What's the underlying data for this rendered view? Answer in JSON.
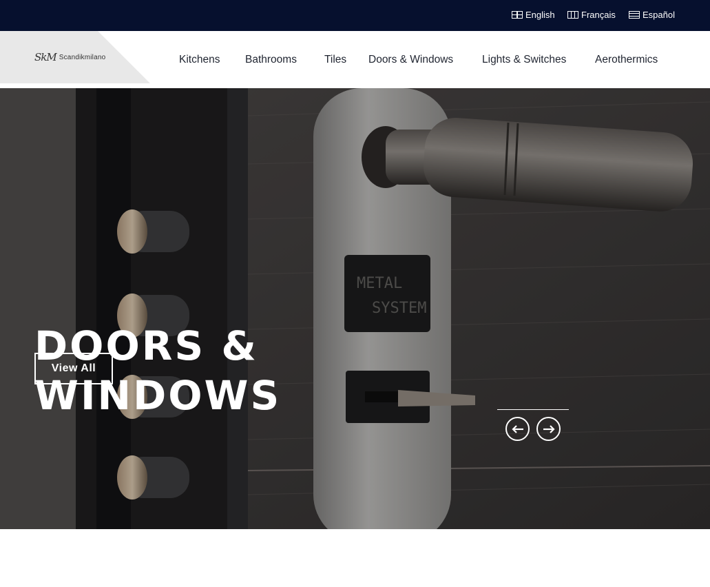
{
  "languages": [
    {
      "label": "English",
      "icon": "uk-flag-icon"
    },
    {
      "label": "Français",
      "icon": "france-flag-icon"
    },
    {
      "label": "Español",
      "icon": "spain-flag-icon"
    }
  ],
  "logo": {
    "mark": "SkM",
    "name": "Scandikmilano"
  },
  "nav": [
    {
      "label": "Kitchens"
    },
    {
      "label": "Bathrooms"
    },
    {
      "label": "Tiles"
    },
    {
      "label": "Doors & Windows"
    },
    {
      "label": "Lights & Switches"
    },
    {
      "label": "Aerothermics"
    }
  ],
  "hero": {
    "title_line1": "DOORS &",
    "title_line2": "WINDOWS",
    "button_label": "View All",
    "lock_plate_text_1": "METAL",
    "lock_plate_text_2": "SYSTEM",
    "prev_icon": "arrow-left-icon",
    "next_icon": "arrow-right-icon"
  },
  "colors": {
    "topbar": "#06102e",
    "logo_bg": "#e8e8e8",
    "nav_text": "#1f2430",
    "hero_text": "#ffffff"
  }
}
